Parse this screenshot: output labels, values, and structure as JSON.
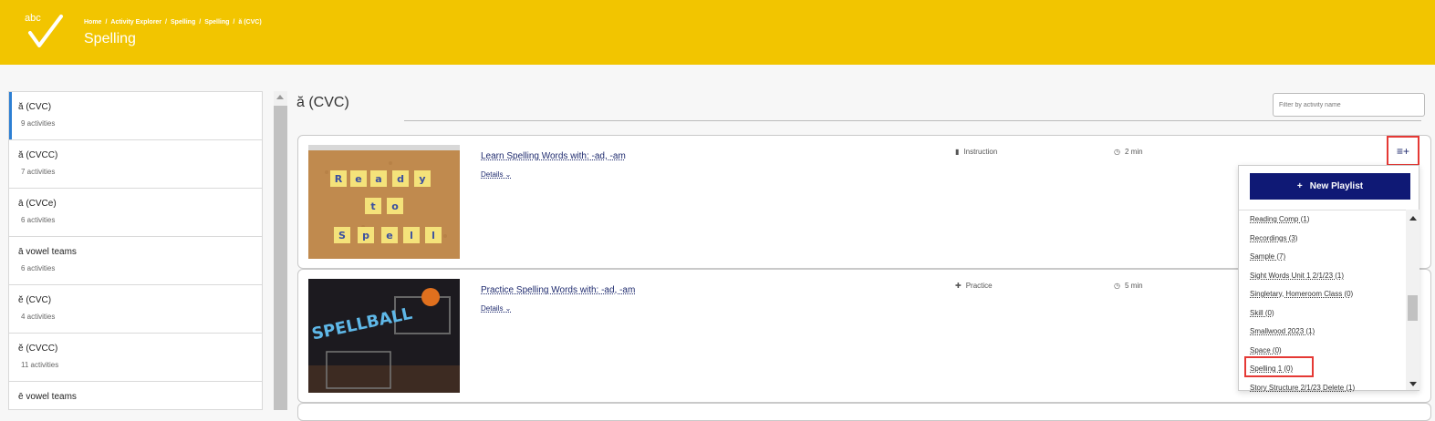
{
  "header": {
    "logo_text": "abc",
    "breadcrumb": [
      "Home",
      "Activity Explorer",
      "Spelling",
      "Spelling",
      "ă (CVC)"
    ],
    "title": "Spelling",
    "bg_color": "#f2c500"
  },
  "sidebar": {
    "items": [
      {
        "title": "ă (CVC)",
        "count": "9 activities",
        "active": true
      },
      {
        "title": "ă (CVCC)",
        "count": "7 activities"
      },
      {
        "title": "ā (CVCe)",
        "count": "6 activities"
      },
      {
        "title": "ā vowel teams",
        "count": "6 activities"
      },
      {
        "title": "ĕ (CVC)",
        "count": "4 activities"
      },
      {
        "title": "ĕ (CVCC)",
        "count": "11 activities"
      },
      {
        "title": "ē vowel teams",
        "count": ""
      }
    ]
  },
  "main": {
    "title": "ă (CVC)",
    "filter_placeholder": "Filter by activity name",
    "activities": [
      {
        "title": "Learn Spelling Words with: -ad, -am",
        "details": "Details",
        "type": "Instruction",
        "type_icon": "book-icon",
        "duration": "2 min"
      },
      {
        "title": "Practice Spelling Words with: -ad, -am",
        "details": "Details",
        "type": "Practice",
        "type_icon": "puzzle-icon",
        "duration": "5 min"
      }
    ],
    "thumb1_letters": [
      "R",
      "e",
      "a",
      "d",
      "y",
      "t",
      "o",
      "S",
      "p",
      "e",
      "l",
      "l"
    ],
    "thumb2_text": "SPELLBALL"
  },
  "dropdown": {
    "new_playlist_label": "New Playlist",
    "items": [
      "Reading Comp (1)",
      "Recordings (3)",
      "Sample (7)",
      "Sight Words Unit 1 2/1/23 (1)",
      "Singletary, Homeroom Class (0)",
      "Skill (0)",
      "Smallwood 2023 (1)",
      "Space (0)",
      "Spelling 1 (0)",
      "Story Structure 2/1/23 Delete (1)"
    ]
  }
}
